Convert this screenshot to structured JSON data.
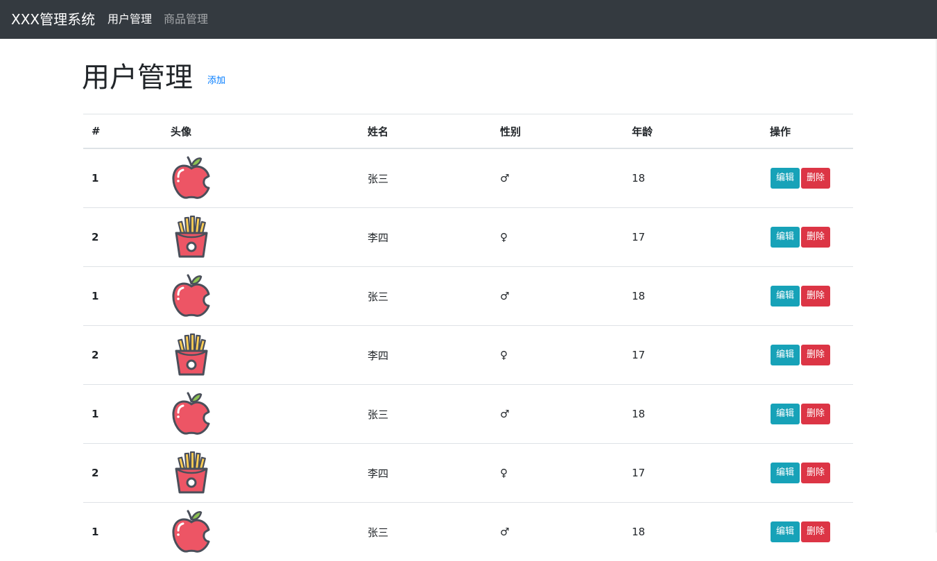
{
  "navbar": {
    "brand": "XXX管理系统",
    "links": [
      {
        "label": "用户管理",
        "active": true
      },
      {
        "label": "商品管理",
        "active": false
      }
    ]
  },
  "page": {
    "title": "用户管理",
    "add_label": "添加"
  },
  "table": {
    "headers": [
      "#",
      "头像",
      "姓名",
      "性别",
      "年龄",
      "操作"
    ],
    "rows": [
      {
        "idx": "1",
        "avatar": "apple-icon",
        "name": "张三",
        "gender": "♂",
        "age": "18"
      },
      {
        "idx": "2",
        "avatar": "fries-icon",
        "name": "李四",
        "gender": "♀",
        "age": "17"
      },
      {
        "idx": "1",
        "avatar": "apple-icon",
        "name": "张三",
        "gender": "♂",
        "age": "18"
      },
      {
        "idx": "2",
        "avatar": "fries-icon",
        "name": "李四",
        "gender": "♀",
        "age": "17"
      },
      {
        "idx": "1",
        "avatar": "apple-icon",
        "name": "张三",
        "gender": "♂",
        "age": "18"
      },
      {
        "idx": "2",
        "avatar": "fries-icon",
        "name": "李四",
        "gender": "♀",
        "age": "17"
      },
      {
        "idx": "1",
        "avatar": "apple-icon",
        "name": "张三",
        "gender": "♂",
        "age": "18"
      }
    ],
    "edit_label": "编辑",
    "delete_label": "删除"
  },
  "colors": {
    "navbar_bg": "#343a40",
    "edit_button": "#17a2b8",
    "delete_button": "#dc3545",
    "link": "#007bff"
  }
}
